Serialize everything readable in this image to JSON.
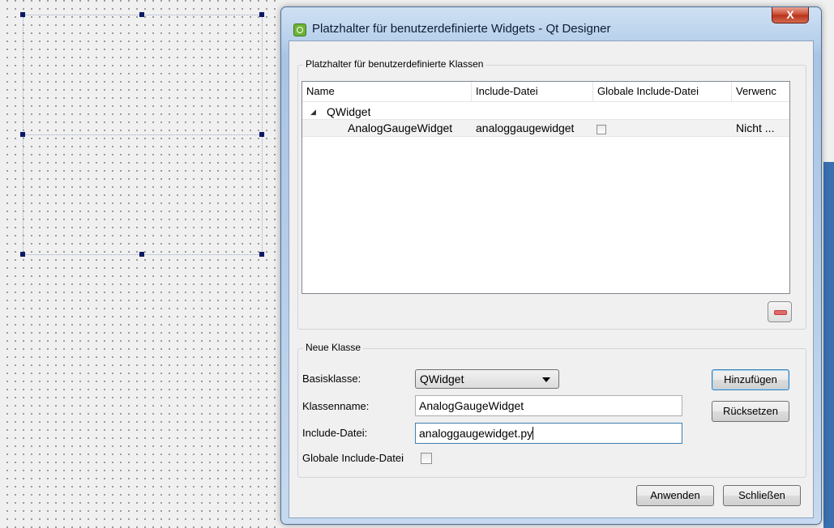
{
  "dialog": {
    "title": "Platzhalter für benutzerdefinierte Widgets - Qt Designer",
    "close_glyph": "X"
  },
  "classes_group": {
    "legend": "Platzhalter für benutzerdefinierte Klassen",
    "columns": [
      "Name",
      "Include-Datei",
      "Globale Include-Datei",
      "Verwenc"
    ],
    "parent_node": {
      "name": "QWidget",
      "expanded": true
    },
    "rows": [
      {
        "name": "AnalogGaugeWidget",
        "include_file": "analoggaugewidget",
        "global_include": false,
        "usage": "Nicht ..."
      }
    ],
    "remove_button_icon": "minus-icon"
  },
  "new_class_group": {
    "legend": "Neue Klasse",
    "base_class_label": "Basisklasse:",
    "base_class_value": "QWidget",
    "class_name_label": "Klassenname:",
    "class_name_value": "AnalogGaugeWidget",
    "include_file_label": "Include-Datei:",
    "include_file_value": "analoggaugewidget.py",
    "global_include_label": "Globale Include-Datei",
    "global_include_checked": false,
    "add_button": "Hinzufügen",
    "reset_button": "Rücksetzen"
  },
  "footer": {
    "apply_button": "Anwenden",
    "close_button": "Schließen"
  },
  "colors": {
    "selection_handle": "#0a1a66",
    "titlebar": "#b9d1ec",
    "close_button": "#c9462c",
    "remove_icon": "#e06a6a"
  }
}
